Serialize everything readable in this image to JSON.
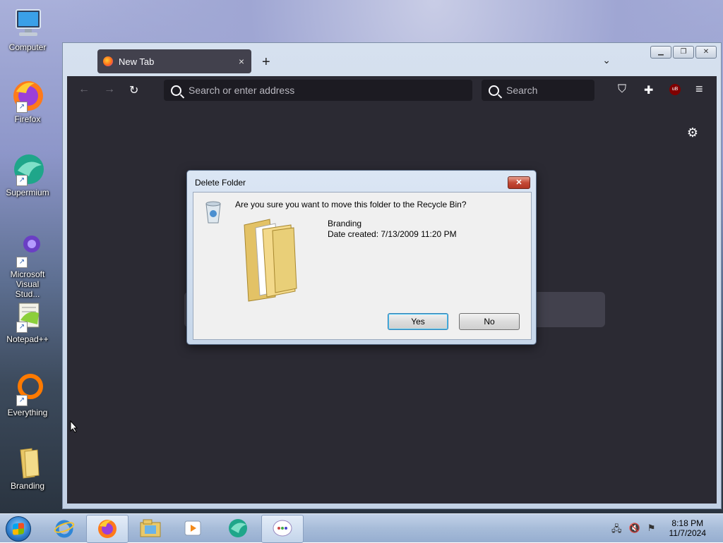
{
  "desktop": {
    "icons": [
      {
        "label": "Computer"
      },
      {
        "label": "Firefox"
      },
      {
        "label": "Supermium"
      },
      {
        "label": "Microsoft Visual Stud..."
      },
      {
        "label": "Notepad++"
      },
      {
        "label": "Everything"
      },
      {
        "label": "Branding"
      }
    ]
  },
  "browser": {
    "tab_title": "New Tab",
    "tab_close": "×",
    "new_tab": "+",
    "tab_list": "⌄",
    "address_placeholder": "Search or enter address",
    "search_placeholder": "Search",
    "back": "←",
    "forward": "→",
    "reload": "↻",
    "pocket": "⛉",
    "extensions": "✚",
    "ublock": "uB",
    "menu": "≡",
    "settings": "⚙"
  },
  "dialog": {
    "title": "Delete Folder",
    "close": "✕",
    "message": "Are you sure you want to move this folder to the Recycle Bin?",
    "folder_name": "Branding",
    "date_created": "Date created: 7/13/2009 11:20 PM",
    "yes_label": "Yes",
    "no_label": "No"
  },
  "taskbar": {
    "time": "8:18 PM",
    "date": "11/7/2024"
  },
  "colors": {
    "browser_bg": "#2b2a33",
    "urlbar_bg": "#1c1b22",
    "accent": "#48c6f5"
  }
}
